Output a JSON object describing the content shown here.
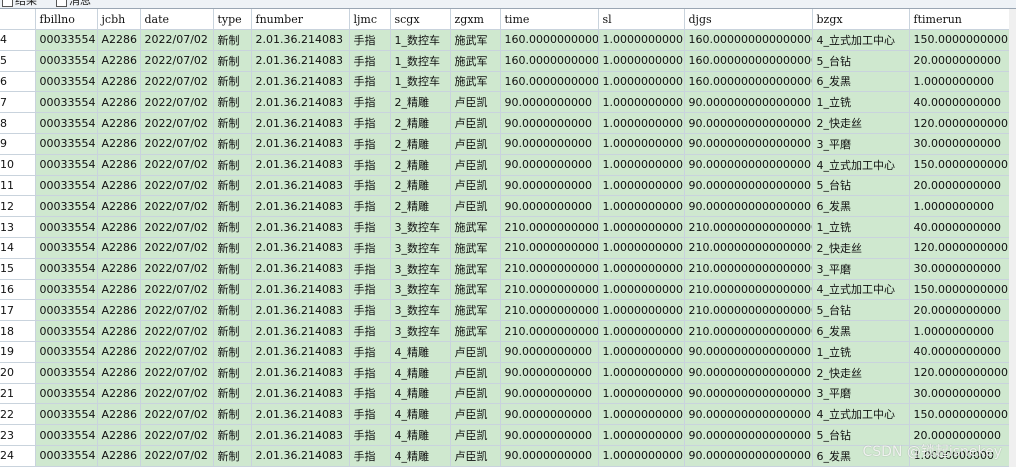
{
  "tabs": [
    "结果",
    "消息"
  ],
  "columns": [
    "",
    "fbillno",
    "jcbh",
    "date",
    "type",
    "fnumber",
    "ljmc",
    "scgx",
    "zgxm",
    "time",
    "sl",
    "djgs",
    "bzgx",
    "ftimerun"
  ],
  "rows": [
    [
      "4",
      "00033554",
      "A2286",
      "2022/07/02",
      "新制",
      "2.01.36.214083",
      "手指",
      "1_数控车",
      "施武军",
      "160.0000000000",
      "1.0000000000",
      "160.000000000000000",
      "4_立式加工中心",
      "150.0000000000"
    ],
    [
      "5",
      "00033554",
      "A2286",
      "2022/07/02",
      "新制",
      "2.01.36.214083",
      "手指",
      "1_数控车",
      "施武军",
      "160.0000000000",
      "1.0000000000",
      "160.000000000000000",
      "5_台钻",
      "20.0000000000"
    ],
    [
      "6",
      "00033554",
      "A2286",
      "2022/07/02",
      "新制",
      "2.01.36.214083",
      "手指",
      "1_数控车",
      "施武军",
      "160.0000000000",
      "1.0000000000",
      "160.000000000000000",
      "6_发黑",
      "1.0000000000"
    ],
    [
      "7",
      "00033554",
      "A2286",
      "2022/07/02",
      "新制",
      "2.01.36.214083",
      "手指",
      "2_精雕",
      "卢臣凯",
      "90.0000000000",
      "1.0000000000",
      "90.000000000000000",
      "1_立铣",
      "40.0000000000"
    ],
    [
      "8",
      "00033554",
      "A2286",
      "2022/07/02",
      "新制",
      "2.01.36.214083",
      "手指",
      "2_精雕",
      "卢臣凯",
      "90.0000000000",
      "1.0000000000",
      "90.000000000000000",
      "2_快走丝",
      "120.0000000000"
    ],
    [
      "9",
      "00033554",
      "A2286",
      "2022/07/02",
      "新制",
      "2.01.36.214083",
      "手指",
      "2_精雕",
      "卢臣凯",
      "90.0000000000",
      "1.0000000000",
      "90.000000000000000",
      "3_平磨",
      "30.0000000000"
    ],
    [
      "10",
      "00033554",
      "A2286",
      "2022/07/02",
      "新制",
      "2.01.36.214083",
      "手指",
      "2_精雕",
      "卢臣凯",
      "90.0000000000",
      "1.0000000000",
      "90.000000000000000",
      "4_立式加工中心",
      "150.0000000000"
    ],
    [
      "11",
      "00033554",
      "A2286",
      "2022/07/02",
      "新制",
      "2.01.36.214083",
      "手指",
      "2_精雕",
      "卢臣凯",
      "90.0000000000",
      "1.0000000000",
      "90.000000000000000",
      "5_台钻",
      "20.0000000000"
    ],
    [
      "12",
      "00033554",
      "A2286",
      "2022/07/02",
      "新制",
      "2.01.36.214083",
      "手指",
      "2_精雕",
      "卢臣凯",
      "90.0000000000",
      "1.0000000000",
      "90.000000000000000",
      "6_发黑",
      "1.0000000000"
    ],
    [
      "13",
      "00033554",
      "A2286",
      "2022/07/02",
      "新制",
      "2.01.36.214083",
      "手指",
      "3_数控车",
      "施武军",
      "210.0000000000",
      "1.0000000000",
      "210.000000000000000",
      "1_立铣",
      "40.0000000000"
    ],
    [
      "14",
      "00033554",
      "A2286",
      "2022/07/02",
      "新制",
      "2.01.36.214083",
      "手指",
      "3_数控车",
      "施武军",
      "210.0000000000",
      "1.0000000000",
      "210.000000000000000",
      "2_快走丝",
      "120.0000000000"
    ],
    [
      "15",
      "00033554",
      "A2286",
      "2022/07/02",
      "新制",
      "2.01.36.214083",
      "手指",
      "3_数控车",
      "施武军",
      "210.0000000000",
      "1.0000000000",
      "210.000000000000000",
      "3_平磨",
      "30.0000000000"
    ],
    [
      "16",
      "00033554",
      "A2286",
      "2022/07/02",
      "新制",
      "2.01.36.214083",
      "手指",
      "3_数控车",
      "施武军",
      "210.0000000000",
      "1.0000000000",
      "210.000000000000000",
      "4_立式加工中心",
      "150.0000000000"
    ],
    [
      "17",
      "00033554",
      "A2286",
      "2022/07/02",
      "新制",
      "2.01.36.214083",
      "手指",
      "3_数控车",
      "施武军",
      "210.0000000000",
      "1.0000000000",
      "210.000000000000000",
      "5_台钻",
      "20.0000000000"
    ],
    [
      "18",
      "00033554",
      "A2286",
      "2022/07/02",
      "新制",
      "2.01.36.214083",
      "手指",
      "3_数控车",
      "施武军",
      "210.0000000000",
      "1.0000000000",
      "210.000000000000000",
      "6_发黑",
      "1.0000000000"
    ],
    [
      "19",
      "00033554",
      "A2286",
      "2022/07/02",
      "新制",
      "2.01.36.214083",
      "手指",
      "4_精雕",
      "卢臣凯",
      "90.0000000000",
      "1.0000000000",
      "90.000000000000000",
      "1_立铣",
      "40.0000000000"
    ],
    [
      "20",
      "00033554",
      "A2286",
      "2022/07/02",
      "新制",
      "2.01.36.214083",
      "手指",
      "4_精雕",
      "卢臣凯",
      "90.0000000000",
      "1.0000000000",
      "90.000000000000000",
      "2_快走丝",
      "120.0000000000"
    ],
    [
      "21",
      "00033554",
      "A2286",
      "2022/07/02",
      "新制",
      "2.01.36.214083",
      "手指",
      "4_精雕",
      "卢臣凯",
      "90.0000000000",
      "1.0000000000",
      "90.000000000000000",
      "3_平磨",
      "30.0000000000"
    ],
    [
      "22",
      "00033554",
      "A2286",
      "2022/07/02",
      "新制",
      "2.01.36.214083",
      "手指",
      "4_精雕",
      "卢臣凯",
      "90.0000000000",
      "1.0000000000",
      "90.000000000000000",
      "4_立式加工中心",
      "150.0000000000"
    ],
    [
      "23",
      "00033554",
      "A2286",
      "2022/07/02",
      "新制",
      "2.01.36.214083",
      "手指",
      "4_精雕",
      "卢臣凯",
      "90.0000000000",
      "1.0000000000",
      "90.000000000000000",
      "5_台钻",
      "20.0000000000"
    ],
    [
      "24",
      "00033554",
      "A2286",
      "2022/07/02",
      "新制",
      "2.01.36.214083",
      "手指",
      "4_精雕",
      "卢臣凯",
      "90.0000000000",
      "1.0000000000",
      "90.000000000000000",
      "6_发黑",
      "1.0000000000"
    ]
  ],
  "watermark": "CSDN @锁起isnekey",
  "colors": {
    "row_fill": "#cfe8cf",
    "grid_line": "#c9d3dd",
    "header_bg": "#ffffff"
  }
}
